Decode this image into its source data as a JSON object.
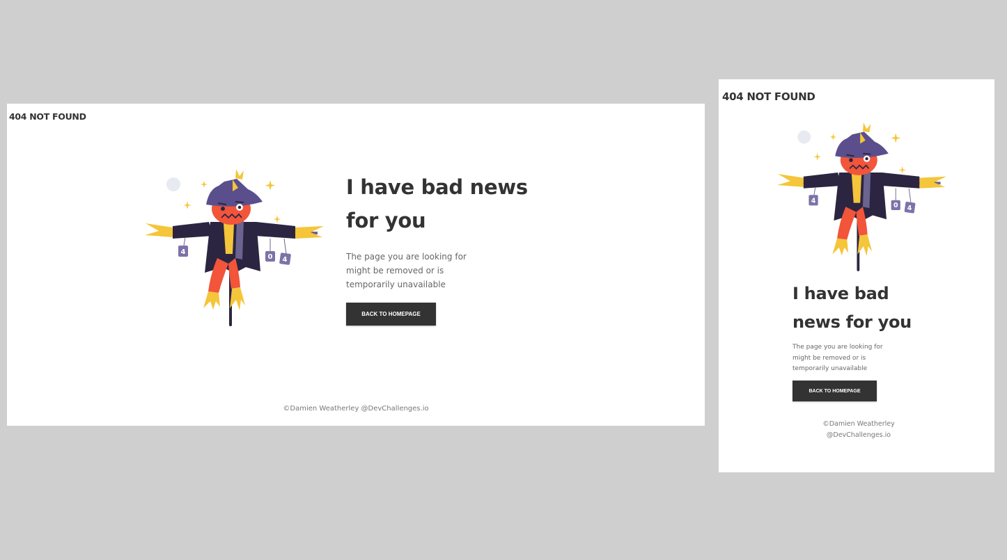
{
  "brand": "404 NOT FOUND",
  "headline": "I have bad news for you",
  "message": "The page you are looking for might be removed or is temporarily unavailable",
  "button_label": "BACK TO HOMEPAGE",
  "credit": "©Damien Weatherley @DevChallenges.io",
  "scarecrow_sign_digits": [
    "4",
    "0",
    "4"
  ],
  "colors": {
    "backdrop": "#d0cfd0",
    "page_background": "#ffffff",
    "text_dark": "#333333",
    "text_muted": "#666666",
    "button_background": "#333333",
    "button_text": "#ffffff",
    "scarecrow_coat": "#2c2541",
    "scarecrow_hat": "#5a4f8c",
    "scarecrow_face": "#f2553a",
    "scarecrow_straw": "#f5c53a",
    "scarecrow_scarf": "#6c6490"
  }
}
